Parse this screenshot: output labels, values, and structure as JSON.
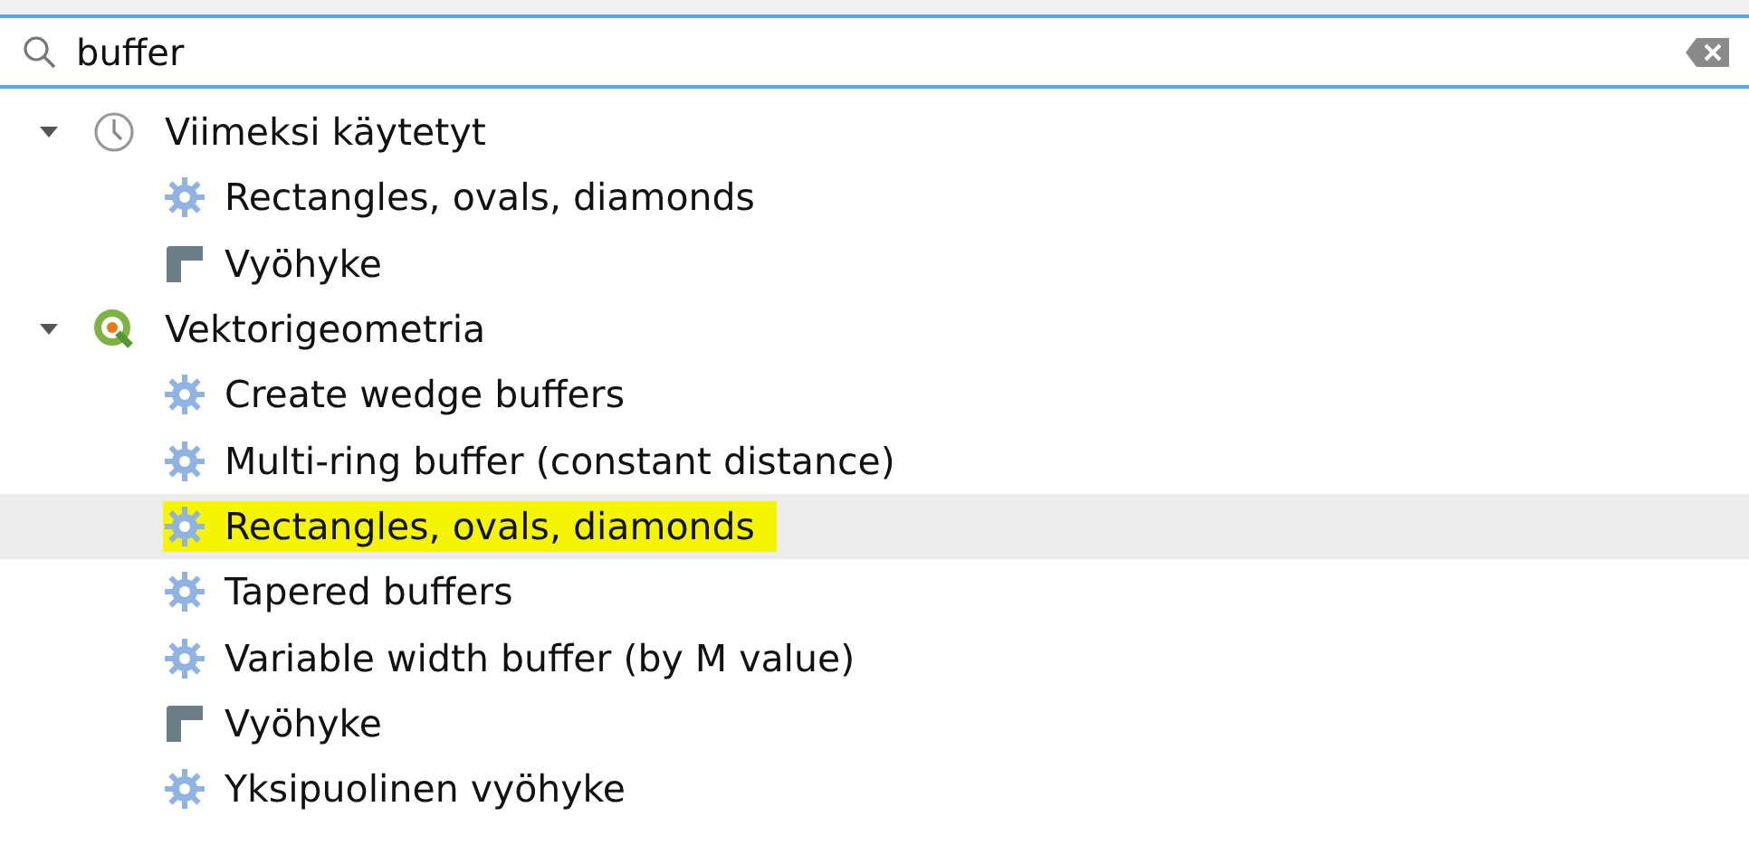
{
  "search": {
    "value": "buffer"
  },
  "tree": [
    {
      "label": "Viimeksi käytetyt",
      "kind": "clock",
      "expanded": true,
      "children": [
        {
          "label": "Rectangles, ovals, diamonds",
          "kind": "gear",
          "selected": false,
          "highlighted": false
        },
        {
          "label": "Vyöhyke",
          "kind": "buffer",
          "selected": false,
          "highlighted": false
        }
      ]
    },
    {
      "label": "Vektorigeometria",
      "kind": "qgis",
      "expanded": true,
      "children": [
        {
          "label": "Create wedge buffers",
          "kind": "gear",
          "selected": false,
          "highlighted": false
        },
        {
          "label": "Multi-ring buffer (constant distance)",
          "kind": "gear",
          "selected": false,
          "highlighted": false
        },
        {
          "label": "Rectangles, ovals, diamonds",
          "kind": "gear",
          "selected": true,
          "highlighted": true
        },
        {
          "label": "Tapered buffers",
          "kind": "gear",
          "selected": false,
          "highlighted": false
        },
        {
          "label": "Variable width buffer (by M value)",
          "kind": "gear",
          "selected": false,
          "highlighted": false
        },
        {
          "label": "Vyöhyke",
          "kind": "buffer",
          "selected": false,
          "highlighted": false
        },
        {
          "label": "Yksipuolinen vyöhyke",
          "kind": "gear",
          "selected": false,
          "highlighted": false
        }
      ]
    }
  ]
}
